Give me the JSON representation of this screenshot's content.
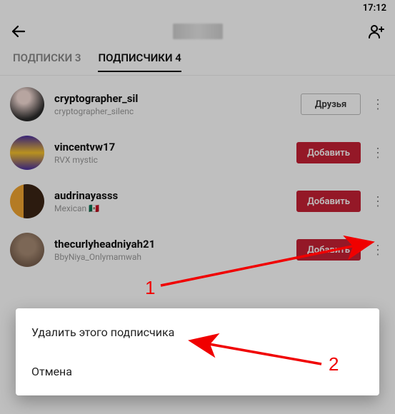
{
  "status": {
    "time": "17:12"
  },
  "tabs": {
    "following": {
      "label": "ПОДПИСКИ",
      "count": "3"
    },
    "followers": {
      "label": "ПОДПИСЧИКИ",
      "count": "4"
    }
  },
  "buttons": {
    "friends": "Друзья",
    "add": "Добавить"
  },
  "followers": [
    {
      "username": "cryptographer_sil",
      "bio": "cryptographer_silenc",
      "action": "friends"
    },
    {
      "username": "vincentvw17",
      "bio": "RVX mystic",
      "action": "add"
    },
    {
      "username": "audrinayasss",
      "bio": "Mexican 🇲🇽",
      "action": "add"
    },
    {
      "username": "thecurlyheadniyah21",
      "bio": "BbyNiya_Onlymamwah",
      "action": "add"
    }
  ],
  "sheet": {
    "remove": "Удалить этого подписчика",
    "cancel": "Отмена"
  },
  "annotations": {
    "one": "1",
    "two": "2"
  }
}
